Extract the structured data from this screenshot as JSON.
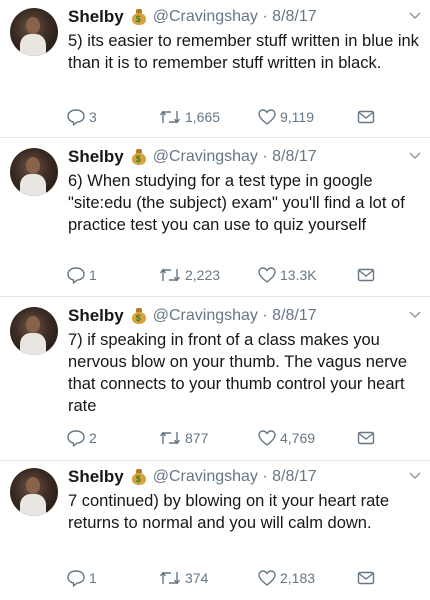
{
  "tweets": [
    {
      "name": "Shelby",
      "handle": "@Cravingshay · 8/8/17",
      "text": "5) its easier to remember stuff written in blue ink than it is to remember stuff written in black.",
      "replies": "3",
      "retweets": "1,665",
      "likes": "9,119"
    },
    {
      "name": "Shelby",
      "handle": "@Cravingshay · 8/8/17",
      "text": "6) When studying for a test type in google \"site:edu (the subject) exam\" you'll find a lot of practice test you can use to quiz yourself",
      "replies": "1",
      "retweets": "2,223",
      "likes": "13.3K"
    },
    {
      "name": "Shelby",
      "handle": "@Cravingshay · 8/8/17",
      "text": "7) if speaking in front of a class makes you nervous blow on your thumb. The vagus nerve that connects to your thumb control your heart rate",
      "replies": "2",
      "retweets": "877",
      "likes": "4,769"
    },
    {
      "name": "Shelby",
      "handle": "@Cravingshay · 8/8/17",
      "text": "7 continued) by blowing on it your heart rate returns to normal and you will calm down.",
      "replies": "1",
      "retweets": "374",
      "likes": "2,183"
    }
  ],
  "icons": {
    "reply": "reply-icon",
    "retweet": "retweet-icon",
    "like": "heart-icon",
    "dm": "envelope-icon",
    "menu": "chevron-down-icon",
    "emoji": "money-bag-emoji-icon"
  },
  "colors": {
    "text": "#14171a",
    "secondary": "#657786",
    "divider": "#e1e8ed"
  }
}
